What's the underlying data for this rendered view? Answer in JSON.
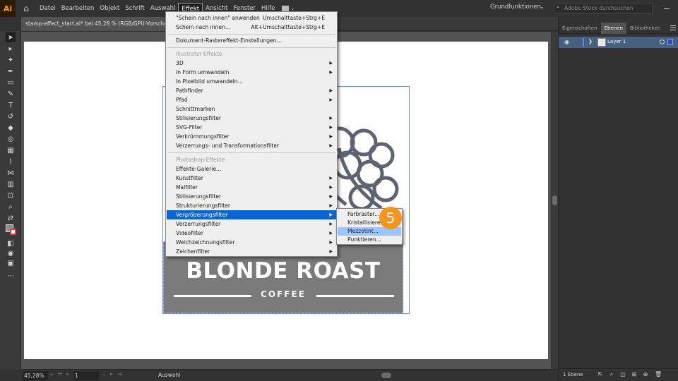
{
  "app": {
    "logo": "Ai"
  },
  "menubar": {
    "items": [
      "Datei",
      "Bearbeiten",
      "Objekt",
      "Schrift",
      "Auswahl",
      "Effekt",
      "Ansicht",
      "Fenster",
      "Hilfe"
    ],
    "active": "Effekt",
    "workspace": "Grundfunktionen",
    "search_placeholder": "Adobe Stock durchsuchen"
  },
  "document": {
    "tab_title": "stamp-effect_start.ai* bei 45,28 % (RGB/GPU-Vorschau)"
  },
  "artwork": {
    "title": "BLONDE ROAST",
    "subtitle": "COFFEE"
  },
  "effect_menu": {
    "apply_last": {
      "label": "\"Schein nach innen\" anwenden",
      "shortcut": "Umschalttaste+Strg+E"
    },
    "last_effect": {
      "label": "Schein nach innen...",
      "shortcut": "Alt+Umschalttaste+Strg+E"
    },
    "raster_settings": "Dokument-Rastereffekt-Einstellungen...",
    "illustrator_header": "Illustrator-Effekte",
    "illustrator_items": [
      "3D",
      "In Form umwandeln",
      "In Pixelbild umwandeln...",
      "Pathfinder",
      "Pfad",
      "Schnittmarken",
      "Stilisierungsfilter",
      "SVG-Filter",
      "Verkrümmungsfilter",
      "Verzerrungs- und Transformationsfilter"
    ],
    "photoshop_header": "Photoshop-Effekte",
    "photoshop_items": [
      "Effekte-Galerie...",
      "Kunstfilter",
      "Malfilter",
      "Stilisierungsfilter",
      "Strukturierungsfilter",
      "Vergröberungsfilter",
      "Verzerrungsfilter",
      "Videofilter",
      "Weichzeichnungsfilter",
      "Zeichenfilter"
    ],
    "highlighted": "Vergröberungsfilter"
  },
  "submenu": {
    "items": [
      "Farbraster...",
      "Kristallisieren...",
      "Mezzotint...",
      "Punktieren..."
    ],
    "highlighted": "Mezzotint..."
  },
  "step_badge": "5",
  "status": {
    "zoom": "45,28%",
    "page": "1",
    "mode": "Auswahl"
  },
  "panel": {
    "tabs": [
      "Eigenschaften",
      "Ebenen",
      "Bibliotheken"
    ],
    "active_tab": "Ebenen",
    "layer_name": "Layer 1",
    "layer_count": "1 Ebene"
  },
  "colors": {
    "accent": "#0a64d4",
    "badge": "#f7941d",
    "layer_highlight": "#46607e"
  }
}
